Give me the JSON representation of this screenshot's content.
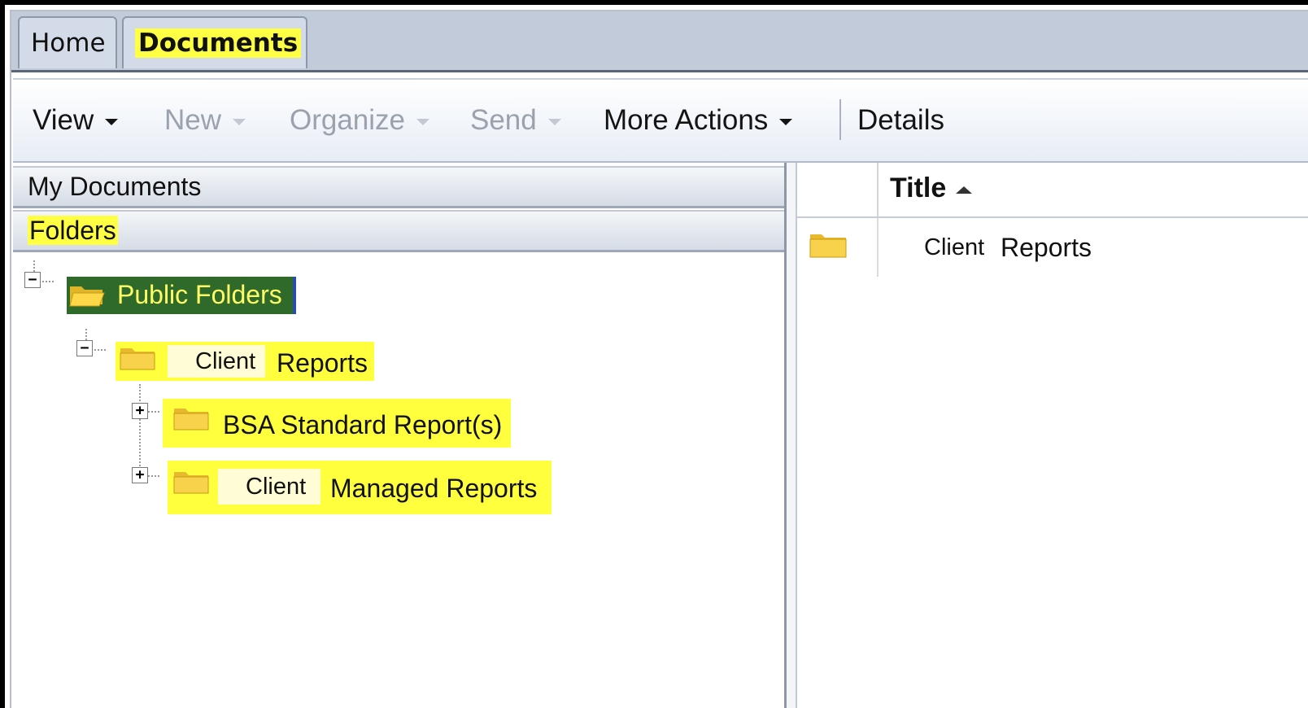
{
  "tabs": [
    {
      "label": "Home",
      "active": false
    },
    {
      "label": "Documents",
      "active": true
    }
  ],
  "toolbar": {
    "view": "View",
    "new": "New",
    "organize": "Organize",
    "send": "Send",
    "more_actions": "More Actions",
    "details": "Details"
  },
  "left_panel": {
    "my_documents": "My Documents",
    "folders": "Folders",
    "tree": {
      "root": {
        "label": "Public Folders",
        "expanded": true,
        "selected": true
      },
      "child": {
        "label_a": "Client",
        "label_b": "Reports",
        "expanded": true
      },
      "grandchildren": [
        {
          "label": "BSA Standard Report(s)",
          "expanded": false
        },
        {
          "label_a": "Client",
          "label_b": "Managed Reports",
          "expanded": false
        }
      ]
    }
  },
  "right_panel": {
    "column_title": "Title",
    "sort": "ascending",
    "rows": [
      {
        "label_a": "Client",
        "label_b": "Reports"
      }
    ]
  },
  "colors": {
    "highlight": "#ffff44",
    "selection_bg": "#2f6a2a",
    "selection_text": "#ffff66",
    "folder_yellow": "#f7d24a"
  }
}
